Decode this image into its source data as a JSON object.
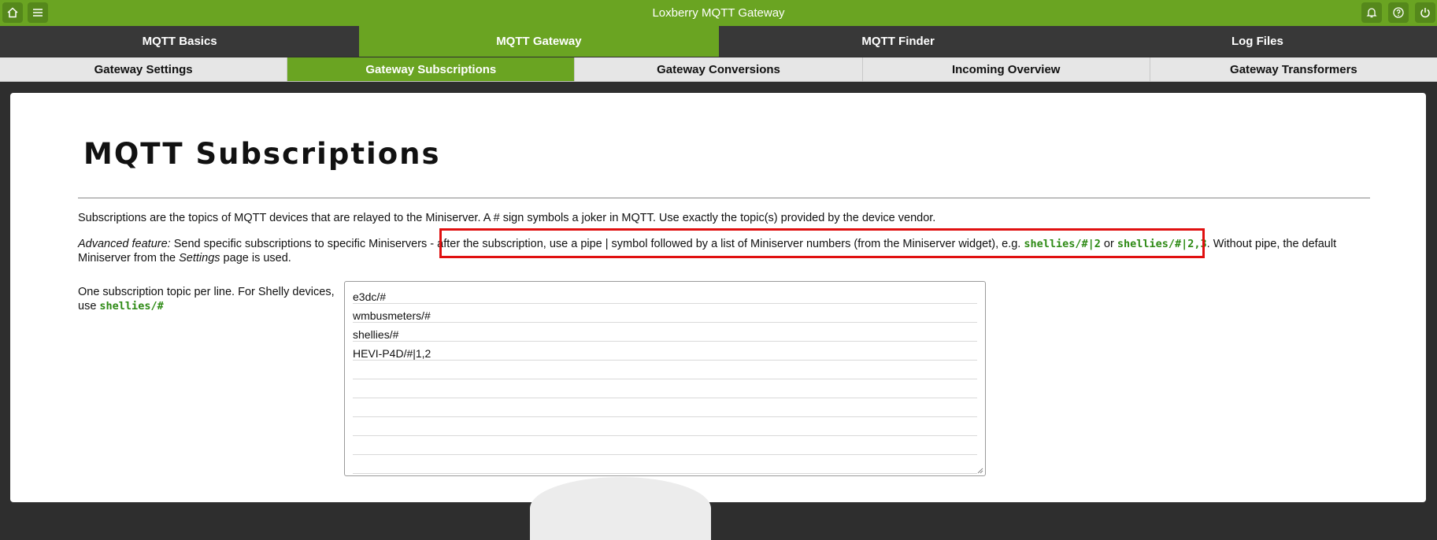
{
  "header": {
    "title": "Loxberry MQTT Gateway",
    "left_icons": [
      "home-icon",
      "menu-icon"
    ],
    "right_icons": [
      "bell-icon",
      "help-icon",
      "power-icon"
    ]
  },
  "tabs": [
    {
      "label": "MQTT Basics",
      "active": false
    },
    {
      "label": "MQTT Gateway",
      "active": true
    },
    {
      "label": "MQTT Finder",
      "active": false
    },
    {
      "label": "Log Files",
      "active": false
    }
  ],
  "subtabs": [
    {
      "label": "Gateway Settings",
      "active": false
    },
    {
      "label": "Gateway Subscriptions",
      "active": true
    },
    {
      "label": "Gateway Conversions",
      "active": false
    },
    {
      "label": "Incoming Overview",
      "active": false
    },
    {
      "label": "Gateway Transformers",
      "active": false
    }
  ],
  "content": {
    "title": "MQTT Subscriptions",
    "intro": "Subscriptions are the topics of MQTT devices that are relayed to the Miniserver. A # sign symbols a joker in MQTT. Use exactly the topic(s) provided by the device vendor.",
    "advanced": {
      "label": "Advanced feature:",
      "text1": " Send specific subscriptions to specific Miniservers - after the subscription, use a pipe | symbol followed by a list of Miniserver numbers (from the Miniserver widget), e.g. ",
      "example1": "shellies/#|2",
      "or": " or ",
      "example2": "shellies/#|2,3",
      "text2": ". Without pipe, the default Miniserver from the ",
      "settings_word": "Settings",
      "text3": " page is used."
    },
    "subscription_label": "One subscription topic per line. For Shelly devices, use ",
    "subscription_example": "shellies/#",
    "subscriptions": [
      "e3dc/#",
      "wmbusmeters/#",
      "shellies/#",
      "HEVI-P4D/#|1,2",
      "",
      "",
      "",
      "",
      "",
      ""
    ]
  },
  "colors": {
    "accent": "#6aa422",
    "highlight_border": "#e01010",
    "code_green": "#2d8a14"
  }
}
